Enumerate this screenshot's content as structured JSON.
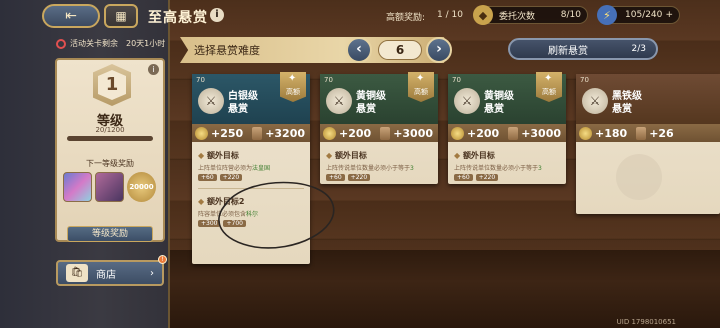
{
  "header": {
    "title": "至高悬赏",
    "reward_label": "高额奖励:",
    "reward_count": "1 / 10",
    "commission_label": "委托次数",
    "commission_count": "8/10",
    "energy": "105/240"
  },
  "left": {
    "event_timer": "活动关卡剩余",
    "event_time": "20天1小时",
    "level_number": "1",
    "level_label": "等级",
    "level_exp": "20/1200",
    "next_level_label": "下一等级奖励",
    "reward_amount": "20000",
    "level_rewards_button": "等级奖励",
    "shop_button": "商店"
  },
  "difficulty": {
    "label": "选择悬赏难度",
    "value": "6",
    "refresh_label": "刷新悬赏",
    "refresh_count": "2/3"
  },
  "cards": [
    {
      "level": "70",
      "name1": "白银级",
      "name2": "悬赏",
      "tag": "高额",
      "reward1": "+250",
      "reward2": "+3200",
      "goal1_title": "额外目标",
      "goal1_desc": "上阵单位阵营必须为",
      "goal1_hl": "法皇国",
      "goal1_r1": "+60",
      "goal1_r2": "+220",
      "goal2_title": "额外目标2",
      "goal2_desc": "阵容单位必须包含",
      "goal2_hl": "科尔",
      "goal2_r1": "+300",
      "goal2_r2": "+700",
      "header_color": "#2f5a6a"
    },
    {
      "level": "70",
      "name1": "黄铜级",
      "name2": "悬赏",
      "tag": "高额",
      "reward1": "+200",
      "reward2": "+3000",
      "goal1_title": "额外目标",
      "goal1_desc": "上阵传说单位数量必须小于等于",
      "goal1_hl": "3",
      "goal1_r1": "+60",
      "goal1_r2": "+220",
      "header_color": "#3a5540"
    },
    {
      "level": "70",
      "name1": "黄铜级",
      "name2": "悬赏",
      "tag": "高额",
      "reward1": "+200",
      "reward2": "+3000",
      "goal1_title": "额外目标",
      "goal1_desc": "上阵传说单位数量必须小于等于",
      "goal1_hl": "3",
      "goal1_r1": "+60",
      "goal1_r2": "+220",
      "header_color": "#3a5540"
    },
    {
      "level": "70",
      "name1": "黑铁级",
      "name2": "悬赏",
      "reward1": "+180",
      "reward2": "+26",
      "header_color": "#6e4a33"
    }
  ],
  "footer": {
    "uid": "UID 1798010651"
  }
}
